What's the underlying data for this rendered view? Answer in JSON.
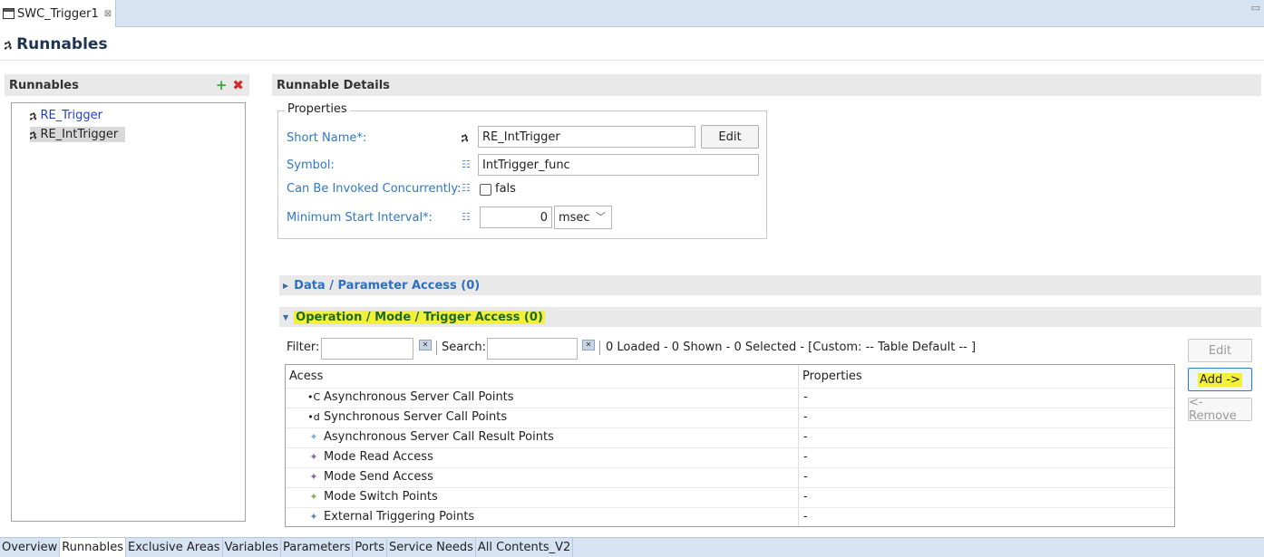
{
  "editor_tab": {
    "title": "SWC_Trigger1",
    "close": "⊠"
  },
  "page": {
    "title": "Runnables",
    "glyph": "ኋ"
  },
  "runnables_panel": {
    "title": "Runnables",
    "add": "+",
    "delete": "✖",
    "items": [
      {
        "label": "RE_Trigger",
        "glyph": "ኋ"
      },
      {
        "label": "RE_IntTrigger",
        "glyph": "ኋ"
      }
    ]
  },
  "details": {
    "title": "Runnable Details",
    "properties": {
      "title": "Properties",
      "short_name_label": "Short Name*:",
      "short_name_value": "RE_IntTrigger",
      "short_name_glyph": "ኋ",
      "edit_label": "Edit",
      "symbol_label": "Symbol:",
      "symbol_value": "IntTrigger_func",
      "concurrent_label": "Can Be Invoked Concurrently:",
      "concurrent_value": "fals",
      "min_start_label": "Minimum Start Interval*:",
      "min_start_value": "0",
      "min_start_unit": "msec",
      "prop_icon": "☷"
    }
  },
  "sections": {
    "data_access": "Data / Parameter Access (0)",
    "operation_access": "Operation / Mode / Trigger Access (0)"
  },
  "filter": {
    "filter_label": "Filter:",
    "search_label": "Search:",
    "status": "0 Loaded - 0 Shown - 0 Selected -  [Custom: -- Table Default -- ]"
  },
  "table": {
    "columns": [
      "Acess",
      "Properties"
    ],
    "rows": [
      {
        "icon": "•C",
        "icon_color": "#111111",
        "label": "Asynchronous Server Call Points",
        "value": "-"
      },
      {
        "icon": "•d",
        "icon_color": "#111111",
        "label": "Synchronous Server Call Points",
        "value": "-"
      },
      {
        "icon": "✦",
        "icon_color": "#7fb0c9",
        "label": "Asynchronous Server Call Result Points",
        "value": "-"
      },
      {
        "icon": "✦",
        "icon_color": "#8a6aa0",
        "label": "Mode Read Access",
        "value": "-"
      },
      {
        "icon": "✦",
        "icon_color": "#8a6aa0",
        "label": "Mode Send Access",
        "value": "-"
      },
      {
        "icon": "✦",
        "icon_color": "#8bb05a",
        "label": "Mode Switch Points",
        "value": "-"
      },
      {
        "icon": "✦",
        "icon_color": "#5a86c8",
        "label": "External Triggering Points",
        "value": "-"
      }
    ]
  },
  "side_buttons": {
    "edit": "Edit",
    "add": "Add ->",
    "remove": "<- Remove"
  },
  "bottom_tabs": [
    "Overview",
    "Runnables",
    "Exclusive Areas",
    "Variables",
    "Parameters",
    "Ports",
    "Service Needs",
    "All Contents_V2"
  ],
  "active_bottom_tab": "Runnables"
}
